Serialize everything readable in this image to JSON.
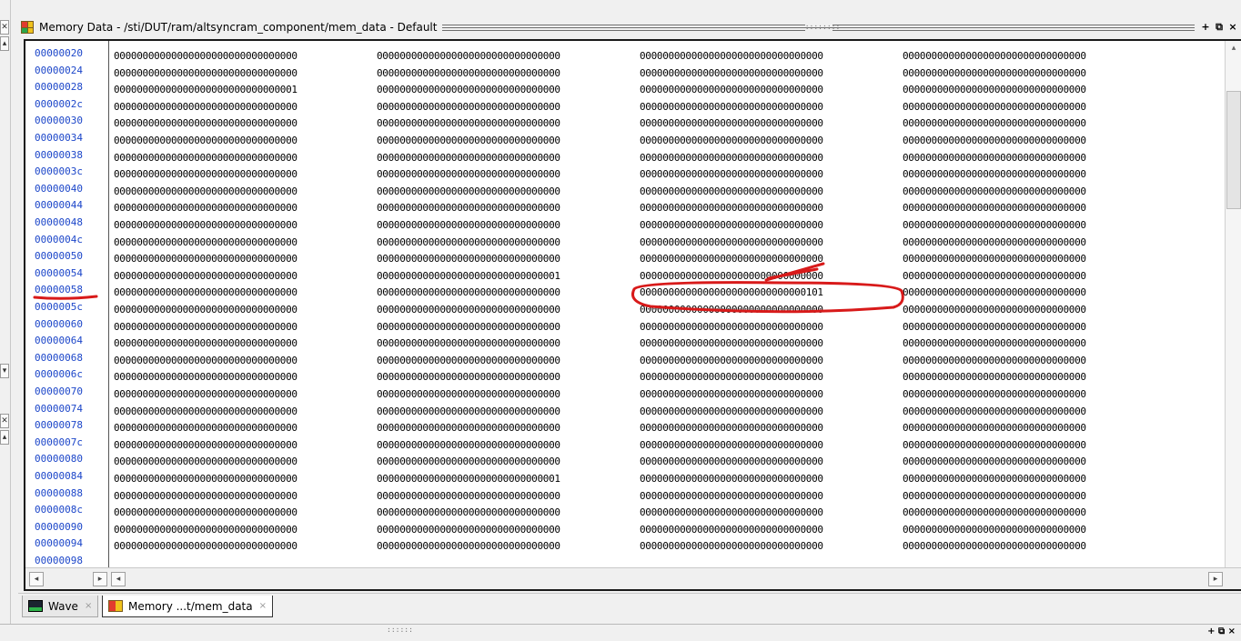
{
  "window": {
    "title": "Memory Data - /sti/DUT/ram/altsyncram_component/mem_data - Default",
    "grip": "::::::::",
    "buttons": [
      "+",
      "⧉",
      "×"
    ]
  },
  "memory": {
    "rows": [
      {
        "addr": "00000020",
        "words": [
          "00000000000000000000000000000000",
          "00000000000000000000000000000000",
          "00000000000000000000000000000000",
          "00000000000000000000000000000000"
        ]
      },
      {
        "addr": "00000024",
        "words": [
          "00000000000000000000000000000000",
          "00000000000000000000000000000000",
          "00000000000000000000000000000000",
          "00000000000000000000000000000000"
        ]
      },
      {
        "addr": "00000028",
        "words": [
          "00000000000000000000000000000001",
          "00000000000000000000000000000000",
          "00000000000000000000000000000000",
          "00000000000000000000000000000000"
        ]
      },
      {
        "addr": "0000002c",
        "words": [
          "00000000000000000000000000000000",
          "00000000000000000000000000000000",
          "00000000000000000000000000000000",
          "00000000000000000000000000000000"
        ]
      },
      {
        "addr": "00000030",
        "words": [
          "00000000000000000000000000000000",
          "00000000000000000000000000000000",
          "00000000000000000000000000000000",
          "00000000000000000000000000000000"
        ]
      },
      {
        "addr": "00000034",
        "words": [
          "00000000000000000000000000000000",
          "00000000000000000000000000000000",
          "00000000000000000000000000000000",
          "00000000000000000000000000000000"
        ]
      },
      {
        "addr": "00000038",
        "words": [
          "00000000000000000000000000000000",
          "00000000000000000000000000000000",
          "00000000000000000000000000000000",
          "00000000000000000000000000000000"
        ]
      },
      {
        "addr": "0000003c",
        "words": [
          "00000000000000000000000000000000",
          "00000000000000000000000000000000",
          "00000000000000000000000000000000",
          "00000000000000000000000000000000"
        ]
      },
      {
        "addr": "00000040",
        "words": [
          "00000000000000000000000000000000",
          "00000000000000000000000000000000",
          "00000000000000000000000000000000",
          "00000000000000000000000000000000"
        ]
      },
      {
        "addr": "00000044",
        "words": [
          "00000000000000000000000000000000",
          "00000000000000000000000000000000",
          "00000000000000000000000000000000",
          "00000000000000000000000000000000"
        ]
      },
      {
        "addr": "00000048",
        "words": [
          "00000000000000000000000000000000",
          "00000000000000000000000000000000",
          "00000000000000000000000000000000",
          "00000000000000000000000000000000"
        ]
      },
      {
        "addr": "0000004c",
        "words": [
          "00000000000000000000000000000000",
          "00000000000000000000000000000000",
          "00000000000000000000000000000000",
          "00000000000000000000000000000000"
        ]
      },
      {
        "addr": "00000050",
        "words": [
          "00000000000000000000000000000000",
          "00000000000000000000000000000000",
          "00000000000000000000000000000000",
          "00000000000000000000000000000000"
        ]
      },
      {
        "addr": "00000054",
        "words": [
          "00000000000000000000000000000000",
          "00000000000000000000000000000001",
          "00000000000000000000000000000000",
          "00000000000000000000000000000000"
        ]
      },
      {
        "addr": "00000058",
        "words": [
          "00000000000000000000000000000000",
          "00000000000000000000000000000000",
          "00000000000000000000000000000101",
          "00000000000000000000000000000000"
        ]
      },
      {
        "addr": "0000005c",
        "words": [
          "00000000000000000000000000000000",
          "00000000000000000000000000000000",
          "00000000000000000000000000000000",
          "00000000000000000000000000000000"
        ]
      },
      {
        "addr": "00000060",
        "words": [
          "00000000000000000000000000000000",
          "00000000000000000000000000000000",
          "00000000000000000000000000000000",
          "00000000000000000000000000000000"
        ]
      },
      {
        "addr": "00000064",
        "words": [
          "00000000000000000000000000000000",
          "00000000000000000000000000000000",
          "00000000000000000000000000000000",
          "00000000000000000000000000000000"
        ]
      },
      {
        "addr": "00000068",
        "words": [
          "00000000000000000000000000000000",
          "00000000000000000000000000000000",
          "00000000000000000000000000000000",
          "00000000000000000000000000000000"
        ]
      },
      {
        "addr": "0000006c",
        "words": [
          "00000000000000000000000000000000",
          "00000000000000000000000000000000",
          "00000000000000000000000000000000",
          "00000000000000000000000000000000"
        ]
      },
      {
        "addr": "00000070",
        "words": [
          "00000000000000000000000000000000",
          "00000000000000000000000000000000",
          "00000000000000000000000000000000",
          "00000000000000000000000000000000"
        ]
      },
      {
        "addr": "00000074",
        "words": [
          "00000000000000000000000000000000",
          "00000000000000000000000000000000",
          "00000000000000000000000000000000",
          "00000000000000000000000000000000"
        ]
      },
      {
        "addr": "00000078",
        "words": [
          "00000000000000000000000000000000",
          "00000000000000000000000000000000",
          "00000000000000000000000000000000",
          "00000000000000000000000000000000"
        ]
      },
      {
        "addr": "0000007c",
        "words": [
          "00000000000000000000000000000000",
          "00000000000000000000000000000000",
          "00000000000000000000000000000000",
          "00000000000000000000000000000000"
        ]
      },
      {
        "addr": "00000080",
        "words": [
          "00000000000000000000000000000000",
          "00000000000000000000000000000000",
          "00000000000000000000000000000000",
          "00000000000000000000000000000000"
        ]
      },
      {
        "addr": "00000084",
        "words": [
          "00000000000000000000000000000000",
          "00000000000000000000000000000001",
          "00000000000000000000000000000000",
          "00000000000000000000000000000000"
        ]
      },
      {
        "addr": "00000088",
        "words": [
          "00000000000000000000000000000000",
          "00000000000000000000000000000000",
          "00000000000000000000000000000000",
          "00000000000000000000000000000000"
        ]
      },
      {
        "addr": "0000008c",
        "words": [
          "00000000000000000000000000000000",
          "00000000000000000000000000000000",
          "00000000000000000000000000000000",
          "00000000000000000000000000000000"
        ]
      },
      {
        "addr": "00000090",
        "words": [
          "00000000000000000000000000000000",
          "00000000000000000000000000000000",
          "00000000000000000000000000000000",
          "00000000000000000000000000000000"
        ]
      },
      {
        "addr": "00000094",
        "words": [
          "00000000000000000000000000000000",
          "00000000000000000000000000000000",
          "00000000000000000000000000000000",
          "00000000000000000000000000000000"
        ]
      },
      {
        "addr": "00000098",
        "words": []
      }
    ]
  },
  "tabs": [
    {
      "label": "Wave",
      "icon": "wave-icon",
      "active": false
    },
    {
      "label": "Memory ...t/mem_data",
      "icon": "memory-icon",
      "active": true
    }
  ],
  "tab_close": "×",
  "bottom_pane": {
    "grip": "::::::",
    "buttons": "+ ⧉ ×"
  },
  "colors": {
    "address": "#1c46c9",
    "annotation": "#d81a1a",
    "window_icon": [
      "#e23b2e",
      "#f0c21c",
      "#2aa64a",
      "#f0c21c"
    ]
  }
}
